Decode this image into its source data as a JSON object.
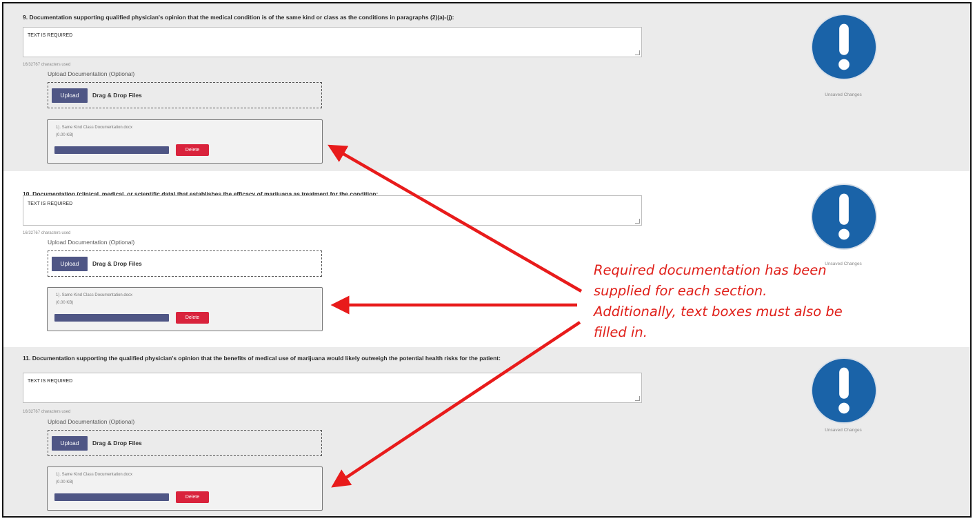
{
  "sections": [
    {
      "question": "9. Documentation supporting qualified physician's opinion that the medical condition is of the same kind or class as the conditions in paragraphs (2)(a)-(j):",
      "text_value": "TEXT IS REQUIRED",
      "char_count": "16/32767 characters used",
      "upload_label": "Upload Documentation (Optional)",
      "upload_button": "Upload",
      "drag_drop": "Drag & Drop Files",
      "file_name": "1). Same Kind Class Documentation.docx",
      "file_size": "(0.00 KB)",
      "upload_progress": 1.0,
      "delete_button": "Delete",
      "status": "Unsaved Changes"
    },
    {
      "question": "10. Documentation (clinical, medical, or scientific data) that establishes the efficacy of marijuana as treatment for the condition:",
      "text_value": "TEXT IS REQUIRED",
      "char_count": "16/32767 characters used",
      "upload_label": "Upload Documentation (Optional)",
      "upload_button": "Upload",
      "drag_drop": "Drag & Drop Files",
      "file_name": "1). Same Kind Class Documentation.docx",
      "file_size": "(0.00 KB)",
      "upload_progress": 1.0,
      "delete_button": "Delete",
      "status": "Unsaved Changes"
    },
    {
      "question": "11. Documentation supporting the qualified physician's opinion that the benefits of medical use of marijuana would likely outweigh the potential health risks for the patient:",
      "text_value": "TEXT IS REQUIRED",
      "char_count": "16/32767 characters used",
      "upload_label": "Upload Documentation (Optional)",
      "upload_button": "Upload",
      "drag_drop": "Drag & Drop Files",
      "file_name": "1). Same Kind Class Documentation.docx",
      "file_size": "(0.00 KB)",
      "upload_progress": 1.0,
      "delete_button": "Delete",
      "status": "Unsaved Changes"
    }
  ],
  "annotation": {
    "lines": [
      "Required documentation has been",
      "supplied for each section.",
      "Additionally, text boxes must also be",
      "filled in."
    ],
    "color": "#e0201a"
  },
  "icons": {
    "status_icon": "exclamation-circle-icon",
    "status_icon_color": "#1a63a8"
  },
  "colors": {
    "upload_button": "#4f5685",
    "delete_button": "#d9233c",
    "progress_bar": "#4f5685"
  }
}
